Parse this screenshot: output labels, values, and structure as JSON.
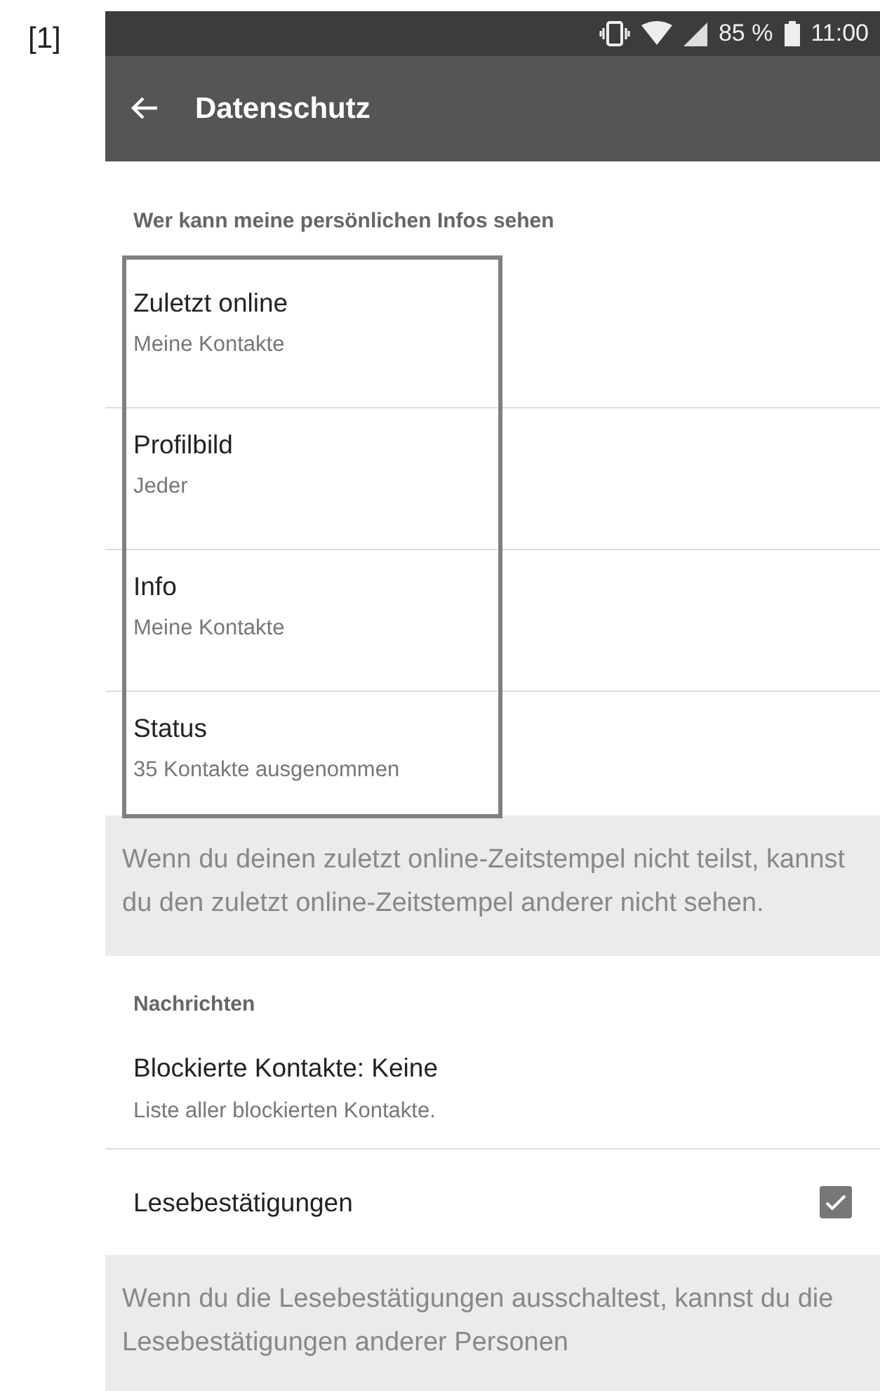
{
  "figure_label": "[1]",
  "status_bar": {
    "battery": "85 %",
    "time": "11:00"
  },
  "toolbar": {
    "title": "Datenschutz"
  },
  "sections": [
    {
      "header": "Wer kann meine persönlichen Infos sehen",
      "highlight_frame": true,
      "items": [
        {
          "kind": "choice",
          "title": "Zuletzt online",
          "subtitle": "Meine Kontakte"
        },
        {
          "kind": "choice",
          "title": "Profilbild",
          "subtitle": "Jeder"
        },
        {
          "kind": "choice",
          "title": "Info",
          "subtitle": "Meine Kontakte"
        },
        {
          "kind": "choice",
          "title": "Status",
          "subtitle": "35 Kontakte ausgenommen"
        }
      ],
      "note": "Wenn du deinen zuletzt online-Zeitstempel nicht teilst, kannst du den zuletzt online-Zeitstempel anderer nicht sehen."
    },
    {
      "header": "Nachrichten",
      "highlight_frame": false,
      "items": [
        {
          "kind": "choice",
          "title": "Blockierte Kontakte: Keine",
          "subtitle": "Liste aller blockierten Kontakte."
        },
        {
          "kind": "checkbox",
          "title": "Lesebestätigungen",
          "checked": true
        }
      ],
      "note": "Wenn du die Lesebestätigungen ausschaltest, kannst du die Lesebestätigungen anderer Personen"
    }
  ]
}
